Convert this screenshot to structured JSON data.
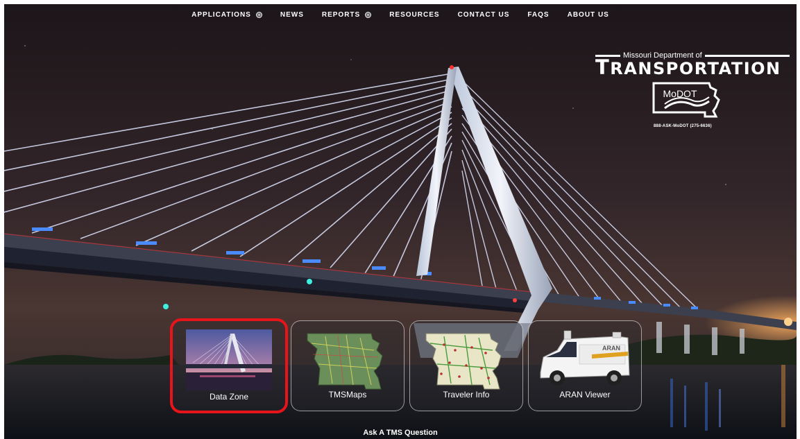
{
  "nav": {
    "items": [
      {
        "label": "APPLICATIONS",
        "has_dropdown": true
      },
      {
        "label": "NEWS",
        "has_dropdown": false
      },
      {
        "label": "REPORTS",
        "has_dropdown": true
      },
      {
        "label": "RESOURCES",
        "has_dropdown": false
      },
      {
        "label": "CONTACT US",
        "has_dropdown": false
      },
      {
        "label": "FAQS",
        "has_dropdown": false
      },
      {
        "label": "ABOUT US",
        "has_dropdown": false
      }
    ]
  },
  "logo": {
    "line1": "Missouri Department of",
    "first_letter": "T",
    "rest": "RANSPORTATION",
    "emblem_text": "MoDOT",
    "phone": "888-ASK-MoDOT (275-6636)"
  },
  "tiles": [
    {
      "label": "Data Zone",
      "icon": "bridge-photo-icon",
      "selected": true
    },
    {
      "label": "TMSMaps",
      "icon": "missouri-map-icon",
      "selected": false
    },
    {
      "label": "Traveler Info",
      "icon": "traveler-map-icon",
      "selected": false
    },
    {
      "label": "ARAN Viewer",
      "icon": "aran-van-icon",
      "selected": false
    }
  ],
  "footer": {
    "ask_label": "Ask A TMS Question"
  },
  "colors": {
    "selected_border": "#e8141b",
    "cable_light": "#dfe6ff",
    "tile_border": "#ffffff"
  }
}
